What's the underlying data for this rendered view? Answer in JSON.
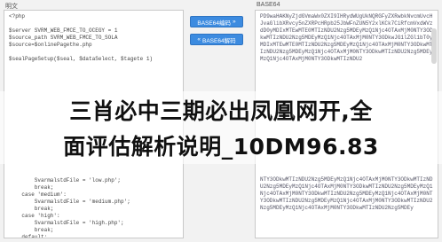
{
  "left_pane": {
    "label": "明文",
    "lines_top": [
      "<?php",
      "",
      "$server SVRM_WEB_FMCE_TO_OCEGY = 1",
      "$source_path SVRM_WEB_FMCE_TO_SOLA",
      "$source=$onlinePagethe.php",
      "",
      "$sealPageSetup($seal, $dataSelect, $tagete 1)"
    ],
    "lines_bottom": [
      "        SvarmalstdFile = 'low.php';",
      "        break;",
      "    case 'medium':",
      "        SvarmalstdFile = 'medium.php';",
      "        break;",
      "    case 'high':",
      "        SvarmalstdFile = 'high.php';",
      "        break;",
      "    default:"
    ]
  },
  "right_pane": {
    "label": "BASE64",
    "text_top": "PD9waHAKNyZjdGVmaWx0ZXI9IHRydWUgUkNQRGFyZXRwbkNvcmUvcHJvaGlibXRvcy5nZXRPcHRpb25JbWFnZUN5Y2xlKCk7CiRfcmVxdWVzdD0yMDIxMTEwMTE0MTIzNDU2Nzg5MDEyMzQ1Njc4OTAxMjM0NTY3ODkwMTIzNDU2Nzg5MDEyMzQ1Njc4OTAxMjM0NTY3ODkwJG1lZGl1bT0yMDIxMTEwMTE0MTIzNDU2Nzg5MDEyMzQ1Njc4OTAxMjM0NTY3ODkwMTIzNDU2Nzg5MDEyMzQ1Njc4OTAxMjM0NTY3ODkwMTIzNDU2Nzg5MDEyMzQ1Njc4OTAxMjM0NTY3ODkwMTIzNDU2",
    "text_bottom": "NTY3ODkwMTIzNDU2Nzg5MDEyMzQ1Njc4OTAxMjM0NTY3ODkwMTIzNDU2Nzg5MDEyMzQ1Njc4OTAxMjM0NTY3ODkwMTIzNDU2Nzg5MDEyMzQ1Njc4OTAxMjM0NTY3ODkwMTIzNDU2Nzg5MDEyMzQ1Njc4OTAxMjM0NTY3ODkwMTIzNDU2Nzg5MDEyMzQ1Njc4OTAxMjM0NTY3ODkwMTIzNDU2Nzg5MDEyMzQ1Njc4OTAxMjM0NTY3ODkwMTIzNDU2Nzg5MDEy"
  },
  "buttons": {
    "encode_label": "BASE64编码",
    "encode_arrow": "»",
    "decode_label": "BASE64解码",
    "decode_arrow": "«"
  },
  "overlay": {
    "line1": "三肖必中三期必出凤凰网开,全",
    "line2": "面评估解析说明_10DM96.83"
  },
  "colors": {
    "button": "#3c8be0",
    "banner": "#ffffff"
  }
}
